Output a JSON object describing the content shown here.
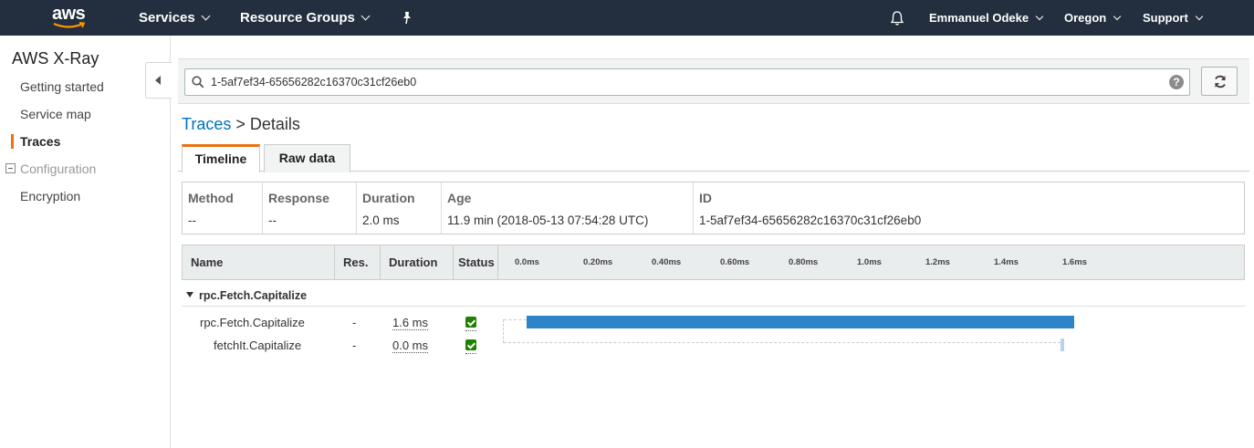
{
  "topnav": {
    "logo": "aws",
    "services": "Services",
    "resource_groups": "Resource Groups",
    "pin_icon": "pin-icon",
    "bell_icon": "bell-icon",
    "user": "Emmanuel Odeke",
    "region": "Oregon",
    "support": "Support"
  },
  "sidebar": {
    "title": "AWS X-Ray",
    "items": [
      {
        "label": "Getting started"
      },
      {
        "label": "Service map"
      },
      {
        "label": "Traces"
      },
      {
        "label": "Configuration"
      },
      {
        "label": "Encryption"
      }
    ]
  },
  "search": {
    "value": "1-5af7ef34-65656282c16370c31cf26eb0",
    "help": "?"
  },
  "breadcrumb": {
    "parent": "Traces",
    "separator": " > ",
    "current": "Details"
  },
  "tabs": [
    {
      "label": "Timeline"
    },
    {
      "label": "Raw data"
    }
  ],
  "info": {
    "headers": [
      "Method",
      "Response",
      "Duration",
      "Age",
      "ID"
    ],
    "values": [
      "--",
      "--",
      "2.0 ms",
      "11.9 min (2018-05-13 07:54:28 UTC)",
      "1-5af7ef34-65656282c16370c31cf26eb0"
    ]
  },
  "timeline": {
    "headers": [
      "Name",
      "Res.",
      "Duration",
      "Status"
    ],
    "ticks": [
      "0.0ms",
      "0.20ms",
      "0.40ms",
      "0.60ms",
      "0.80ms",
      "1.0ms",
      "1.2ms",
      "1.4ms",
      "1.6ms"
    ],
    "group": "rpc.Fetch.Capitalize",
    "rows": [
      {
        "name": "rpc.Fetch.Capitalize",
        "res": "-",
        "duration": "1.6 ms",
        "status": "ok",
        "start_ms": 0.0,
        "end_ms": 1.6
      },
      {
        "name": "fetchIt.Capitalize",
        "res": "-",
        "duration": "0.0 ms",
        "status": "ok",
        "start_ms": 1.56,
        "end_ms": 1.56
      }
    ],
    "colors": {
      "bar": "#2e84c6",
      "bar_small": "#b9d3ea",
      "accent": "#ec7211",
      "status_ok": "#1d8102"
    }
  }
}
